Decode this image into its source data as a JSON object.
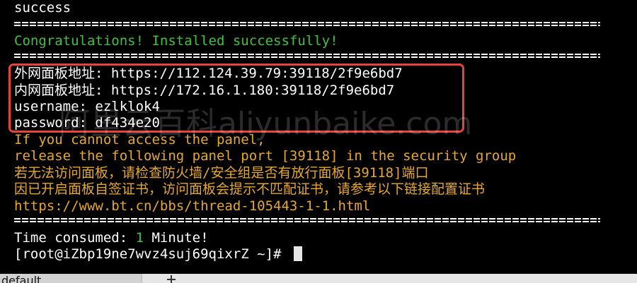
{
  "terminal": {
    "status_line": "success",
    "congrats_line": "Congratulations! Installed successfully!",
    "credentials": {
      "external_panel": "外网面板地址: https://112.124.39.79:39118/2f9e6bd7",
      "internal_panel": "内网面板地址: https://172.16.1.180:39118/2f9e6bd7",
      "username": "username: ezlklok4",
      "password": "password: df434e20"
    },
    "notice": {
      "line1": "If you cannot access the panel,",
      "line2": "release the following panel port [39118] in the security group",
      "line3": "若无法访问面板，请检查防火墙/安全组是否有放行面板[39118]端口",
      "line4": "因已开启面板自签证书，访问面板会提示不匹配证书，请参考以下链接配置证书",
      "link": "https://www.bt.cn/bbs/thread-105443-1-1.html"
    },
    "time_prefix": "Time consumed: ",
    "time_value": "1",
    "time_suffix": " Minute!",
    "prompt": "[root@iZbp19ne7wvz4suj69qixrZ ~]# "
  },
  "watermark": {
    "text_cn": "阿里云百科",
    "text_en": "aliyunbaike.com"
  },
  "tabbar": {
    "active_tab_label": "default",
    "new_tab_icon": "plus-icon"
  },
  "colors": {
    "background": "#000000",
    "success_green": "#3fc03f",
    "notice_orange": "#e6a82a",
    "highlight_red": "#e8433a"
  }
}
